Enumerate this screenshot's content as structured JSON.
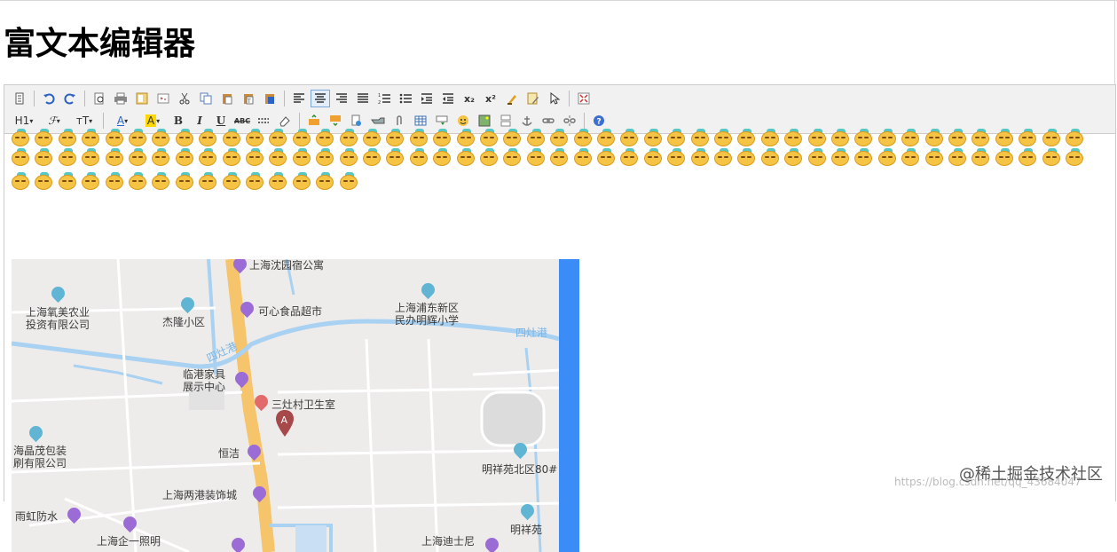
{
  "page": {
    "title": "富文本编辑器"
  },
  "toolbar": {
    "row1": [
      "source-icon",
      "undo-icon",
      "redo-icon",
      "preview-icon",
      "print-icon",
      "template-icon",
      "code-icon",
      "cut-icon",
      "copy-icon",
      "paste-icon",
      "paste-text-icon",
      "paste-word-icon",
      "align-left-icon",
      "align-center-icon",
      "align-right-icon",
      "justify-icon",
      "ordered-list-icon",
      "bullet-list-icon",
      "indent-icon",
      "outdent-icon",
      "subscript-icon",
      "superscript-icon",
      "clear-format-icon",
      "format-painter-icon",
      "select-all-icon",
      "fullscreen-icon"
    ],
    "heading_label": "H1",
    "font_family_label": "𝓕",
    "font_size_label": "тT",
    "font_color_label": "A",
    "highlight_label": "A",
    "bold_label": "B",
    "italic_label": "I",
    "underline_label": "U",
    "strike_label": "ABC",
    "subscript_label": "x₂",
    "superscript_label": "x²"
  },
  "emoji": {
    "name": "sleepy-face-emoji",
    "row_count": 46,
    "third_row_count": 15
  },
  "map": {
    "labels": [
      "上海沈园宿公寓",
      "可心食品超市",
      "上海浦东新区\n民办明辉小学",
      "上海氧美农业\n投资有限公司",
      "杰隆小区",
      "四灶港",
      "四灶港",
      "临港家具\n展示中心",
      "三灶村卫生室",
      "海晶茂包装\n刷有限公司",
      "恒洁",
      "明祥苑北区80#",
      "上海两港装饰城",
      "雨虹防水",
      "上海企一照明",
      "上海迪士尼",
      "明祥苑"
    ],
    "marker_label": "A"
  },
  "watermark": {
    "main": "@稀土掘金技术社区",
    "sub": "https://blog.csdn.net/qq_43684047"
  }
}
